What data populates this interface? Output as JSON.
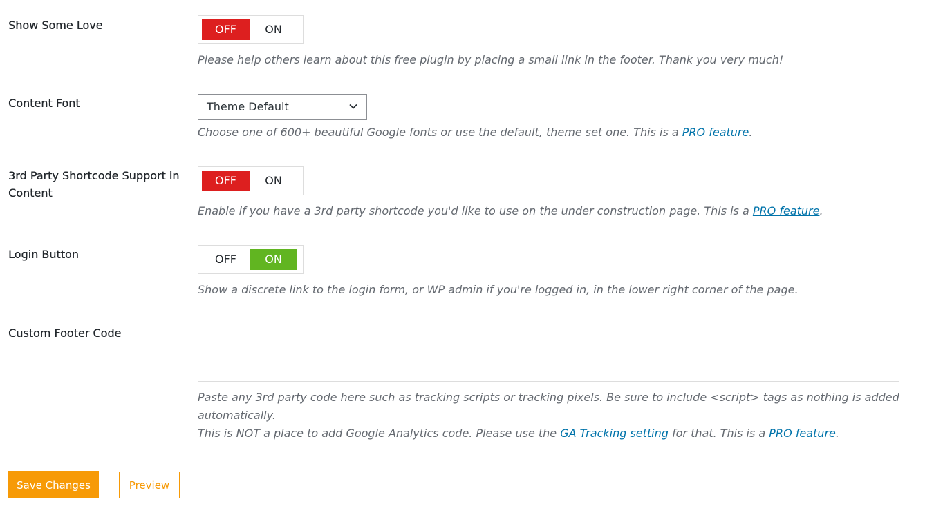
{
  "settings": [
    {
      "label": "Show Some Love",
      "off_label": "OFF",
      "on_label": "ON",
      "state": "OFF",
      "description": "Please help others learn about this free plugin by placing a small link in the footer. Thank you very much!"
    },
    {
      "label": "Content Font",
      "selected": "Theme Default",
      "description": "Choose one of 600+ beautiful Google fonts or use the default, theme set one. This is a ",
      "link": "PRO feature",
      "suffix": "."
    },
    {
      "label": "3rd Party Shortcode Support in Content",
      "off_label": "OFF",
      "on_label": "ON",
      "state": "OFF",
      "description": "Enable if you have a 3rd party shortcode you'd like to use on the under construction page. This is a ",
      "link": "PRO feature",
      "suffix": "."
    },
    {
      "label": "Login Button",
      "off_label": "OFF",
      "on_label": "ON",
      "state": "ON",
      "description": "Show a discrete link to the login form, or WP admin if you're logged in, in the lower right corner of the page."
    },
    {
      "label": "Custom Footer Code",
      "value": "",
      "description_line1": "Paste any 3rd party code here such as tracking scripts or tracking pixels. Be sure to include <script> tags as nothing is added",
      "description_line2": "automatically.",
      "description_line3_prefix": "This is NOT a place to add Google Analytics code. Please use the ",
      "ga_link": "GA Tracking setting",
      "description_line3_middle": " for that. This is a ",
      "pro_link": "PRO feature",
      "suffix": "."
    }
  ],
  "actions": {
    "save_label": "Save Changes",
    "preview_label": "Preview"
  },
  "colors": {
    "off_active": "#dd1f1f",
    "on_active": "#61b521",
    "accent": "#f79a06",
    "link": "#0073aa"
  }
}
